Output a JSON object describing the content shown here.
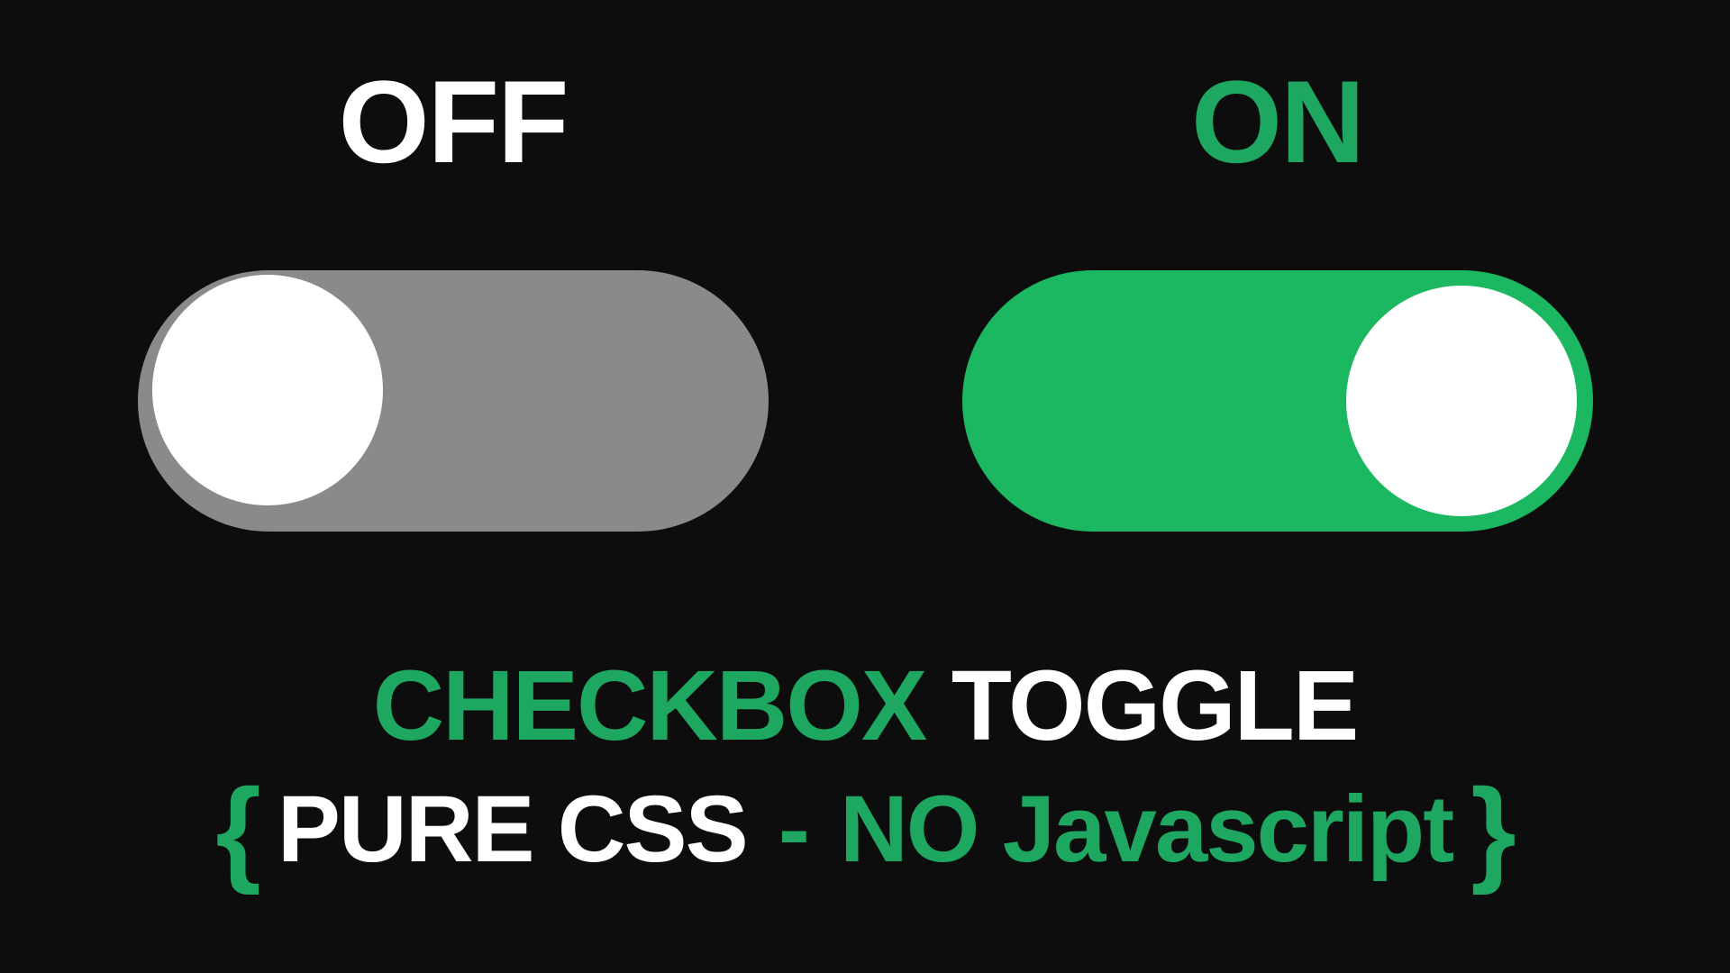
{
  "toggles": {
    "off": {
      "label": "OFF",
      "state": "off"
    },
    "on": {
      "label": "ON",
      "state": "on"
    }
  },
  "title": {
    "line1_word1": "CHECKBOX",
    "line1_word2": "TOGGLE",
    "line2_brace_open": "{",
    "line2_part1": "PURE CSS",
    "line2_dash": "-",
    "line2_part2": "NO Javascript",
    "line2_brace_close": "}"
  },
  "colors": {
    "background": "#0d0d0d",
    "green": "#1ea760",
    "toggle_on": "#1cb861",
    "toggle_off": "#8a8a8a",
    "white": "#ffffff"
  }
}
